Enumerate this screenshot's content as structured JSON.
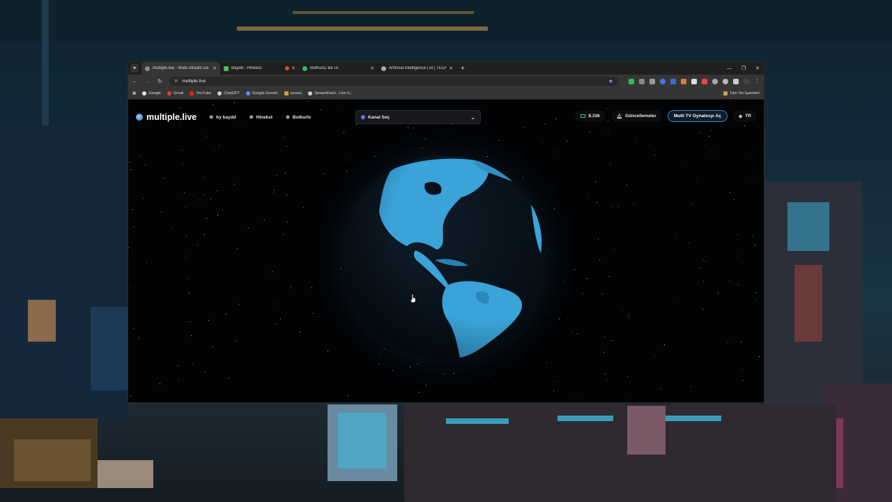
{
  "browser": {
    "tabs": [
      {
        "title": "multiple.live - Multi-Stream Da",
        "icon": "globe-icon",
        "active": true
      },
      {
        "title": "Baydd - HiNekst",
        "icon": "kick-icon",
        "recording": true
      },
      {
        "title": "BotKurtZ BETA",
        "icon": "green-icon"
      },
      {
        "title": "Artificial Intelligence | AI | TECH",
        "icon": "web-icon"
      }
    ],
    "url": "multiple.live",
    "bookmarks": [
      {
        "label": "Google",
        "color": "#eaeaea"
      },
      {
        "label": "Gmail",
        "color": "#d64541"
      },
      {
        "label": "YouTube",
        "color": "#e62117"
      },
      {
        "label": "ChatGPT",
        "color": "#cfcfcf"
      },
      {
        "label": "Google Gemini",
        "color": "#5a8df0"
      },
      {
        "label": "ssssss",
        "color": "#c9a24a"
      },
      {
        "label": "StreamDash - Live S...",
        "color": "#cfcfcf"
      }
    ],
    "bookmarks_right": "Tüm Yer İşaretleri"
  },
  "site": {
    "brand": "multiple.live",
    "nav": [
      "by baydd",
      "Hinekst",
      "Botkurtz"
    ],
    "channel_select": "Kanal Seç",
    "viewer_count": "8.336",
    "updates": "Güncellemeler",
    "open_player": "Multi TV Oynatıcıyı Aç",
    "language": "TR"
  },
  "colors": {
    "accent": "#2f86d4",
    "land": "#3aa3d8",
    "ocean": "#08111a"
  }
}
